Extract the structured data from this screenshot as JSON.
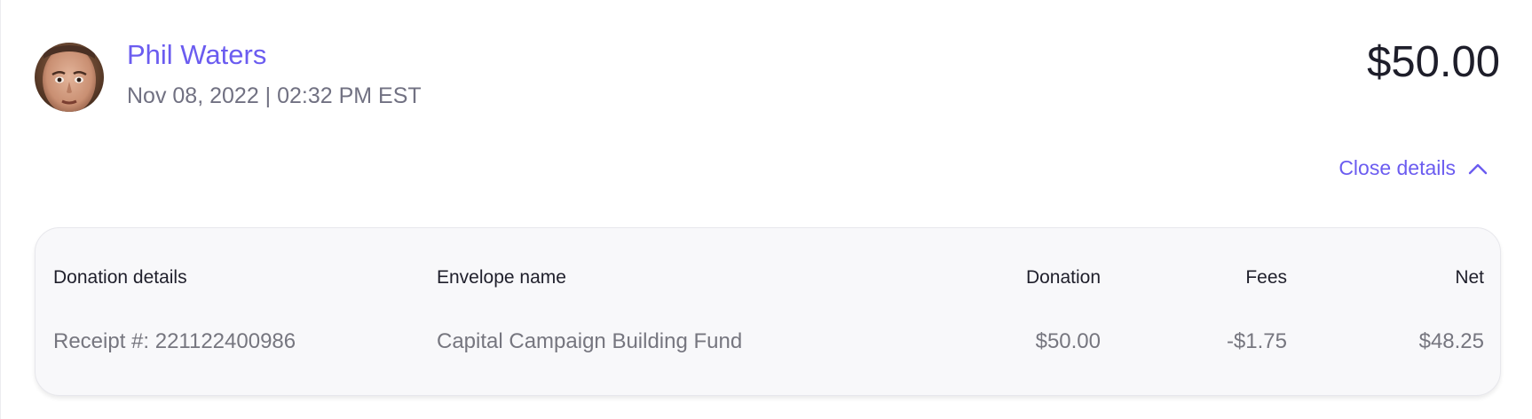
{
  "donor": {
    "avatar_icon": "person-photo-avatar",
    "name": "Phil Waters",
    "date": "Nov 08, 2022 | 02:32 PM EST"
  },
  "total": "$50.00",
  "toggle": {
    "label": "Close details",
    "icon": "chevron-up-icon"
  },
  "table": {
    "headers": {
      "details": "Donation details",
      "envelope": "Envelope name",
      "donation": "Donation",
      "fees": "Fees",
      "net": "Net"
    },
    "rows": [
      {
        "details": "Receipt #: 221122400986",
        "envelope": "Capital Campaign Building Fund",
        "donation": "$50.00",
        "fees": "-$1.75",
        "net": "$48.25"
      }
    ]
  },
  "colors": {
    "accent": "#6b5cf0",
    "text_dark": "#1e1e2a",
    "text_muted": "#76767f",
    "card_bg": "#f8f8fa"
  }
}
